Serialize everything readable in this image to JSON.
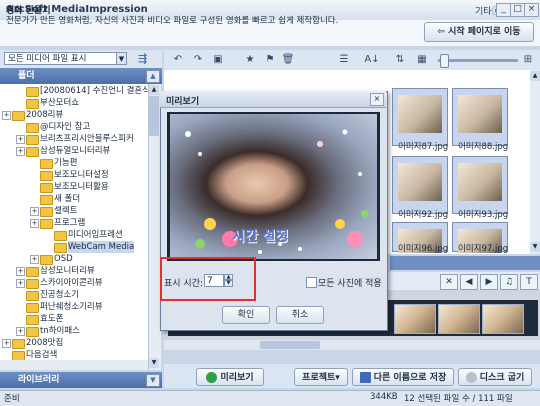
{
  "app": {
    "title": "ArcSoft MediaImpression",
    "menu_etc": "기타ⓧ",
    "window_buttons": [
      "_",
      "□",
      "×"
    ]
  },
  "header": {
    "title": "영화 만들기",
    "description": "전문가가 만든 영화처럼, 자신의 사진과 비디오 파일로 구성된 영화를 빠르고 쉽게 제작합니다.",
    "start_button": "시작 페이지로 이동"
  },
  "left": {
    "view_select": "모든 미디어 파일 표시",
    "folders_label": "폴더",
    "library_label": "라이브러리",
    "tree": [
      {
        "label": "[20080614] 수진언니 결혼식",
        "level": 2,
        "exp": false
      },
      {
        "label": "부산모터쇼",
        "level": 2,
        "exp": false
      },
      {
        "label": "2008리뷰",
        "level": 1,
        "exp": true
      },
      {
        "label": "@디자인 참고",
        "level": 2,
        "exp": false
      },
      {
        "label": "브리츠프리시안블루스피커",
        "level": 2,
        "exp": true
      },
      {
        "label": "삼성듀얼모니터리뷰",
        "level": 2,
        "exp": true
      },
      {
        "label": "기능편",
        "level": 3,
        "exp": false
      },
      {
        "label": "보조모니터설정",
        "level": 3,
        "exp": false
      },
      {
        "label": "보조모니터활용",
        "level": 3,
        "exp": false
      },
      {
        "label": "새 폴더",
        "level": 3,
        "exp": false
      },
      {
        "label": "셀렉트",
        "level": 3,
        "exp": true
      },
      {
        "label": "프로그램",
        "level": 3,
        "exp": true
      },
      {
        "label": "미디어임프레션",
        "level": 4,
        "exp": false
      },
      {
        "label": "WebCam Media",
        "level": 4,
        "exp": false,
        "selected": true
      },
      {
        "label": "OSD",
        "level": 3,
        "exp": true
      },
      {
        "label": "삼성모니터리뷰",
        "level": 2,
        "exp": true
      },
      {
        "label": "스카이아이콘리뷰",
        "level": 2,
        "exp": true
      },
      {
        "label": "진공청소기",
        "level": 2,
        "exp": false
      },
      {
        "label": "퍼난쉐청소기리뷰",
        "level": 2,
        "exp": false
      },
      {
        "label": "효도폰",
        "level": 2,
        "exp": false
      },
      {
        "label": "tn하이패스",
        "level": 2,
        "exp": true
      },
      {
        "label": "2008맛집",
        "level": 1,
        "exp": true
      },
      {
        "label": "다음검색",
        "level": 1,
        "exp": false
      }
    ]
  },
  "gallery": {
    "items": [
      {
        "label": "이미지87.jpg"
      },
      {
        "label": "이미지88.jpg"
      },
      {
        "label": "이미지92.jpg"
      },
      {
        "label": "이미지93.jpg"
      },
      {
        "label": "이미지96.jpg"
      },
      {
        "label": "이미지97.jpg"
      }
    ]
  },
  "dialog": {
    "title": "미리보기",
    "caption": "시간 설정",
    "show_time_label": "표시 시간:",
    "show_time_value": "7",
    "apply_all_label": "모든 사진에 적용",
    "ok": "확인",
    "cancel": "취소"
  },
  "actions": {
    "preview": "미리보기",
    "project": "프로젝트",
    "save_as": "다른 이름으로 저장",
    "burn": "디스크 굽기"
  },
  "status": {
    "left": "준비",
    "size": "344KB",
    "selection": "12 선택된 파일 수 / 111 파일"
  },
  "colors": {
    "accent": "#4c6fa9",
    "highlight": "#e03030"
  }
}
